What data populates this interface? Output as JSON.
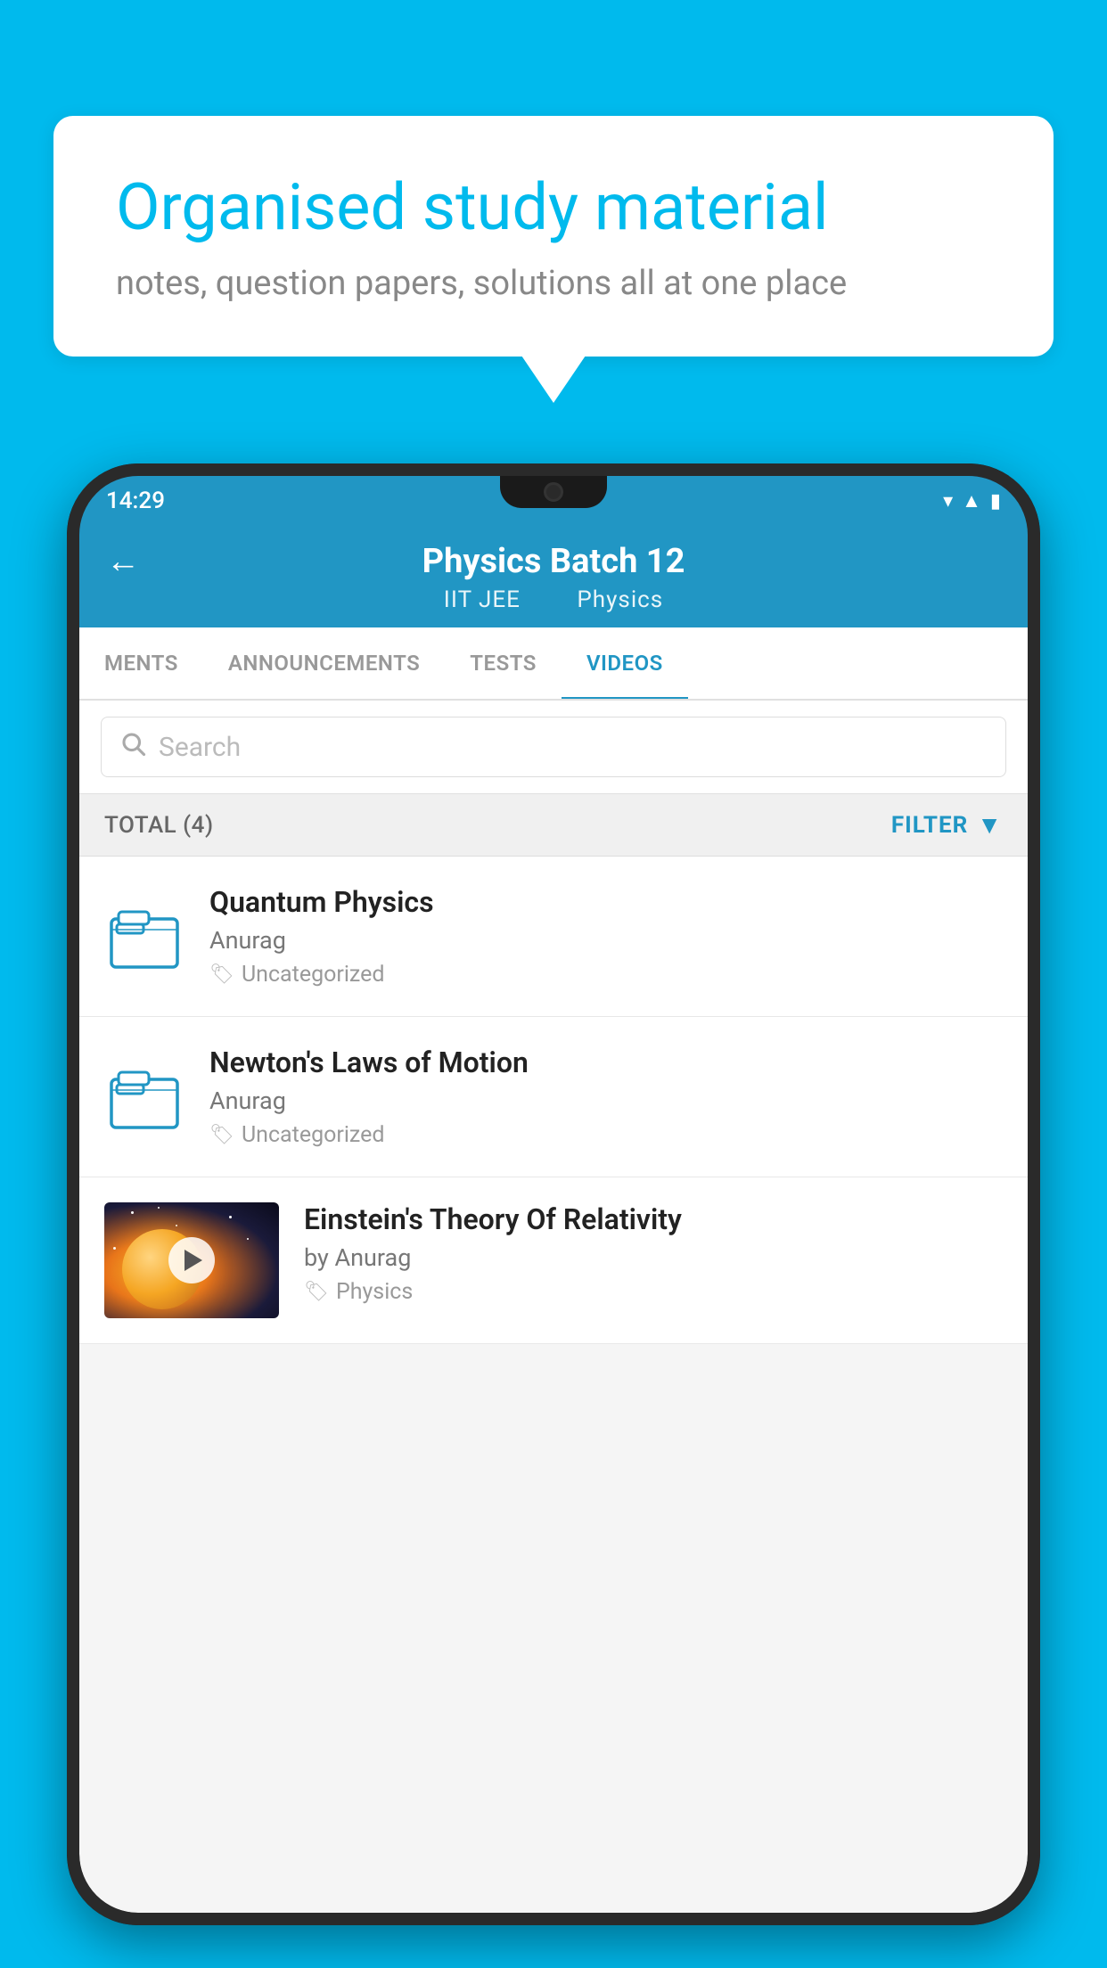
{
  "hero": {
    "title": "Organised study material",
    "subtitle": "notes, question papers, solutions all at one place"
  },
  "phone": {
    "status_bar": {
      "time": "14:29"
    },
    "header": {
      "title": "Physics Batch 12",
      "subtitle_part1": "IIT JEE",
      "subtitle_part2": "Physics",
      "back_label": "←"
    },
    "tabs": [
      {
        "label": "MENTS",
        "active": false
      },
      {
        "label": "ANNOUNCEMENTS",
        "active": false
      },
      {
        "label": "TESTS",
        "active": false
      },
      {
        "label": "VIDEOS",
        "active": true
      }
    ],
    "search": {
      "placeholder": "Search"
    },
    "filter": {
      "total_label": "TOTAL (4)",
      "filter_label": "FILTER"
    },
    "videos": [
      {
        "title": "Quantum Physics",
        "author": "Anurag",
        "tag": "Uncategorized",
        "has_thumbnail": false
      },
      {
        "title": "Newton's Laws of Motion",
        "author": "Anurag",
        "tag": "Uncategorized",
        "has_thumbnail": false
      },
      {
        "title": "Einstein's Theory Of Relativity",
        "author": "by Anurag",
        "tag": "Physics",
        "has_thumbnail": true
      }
    ]
  }
}
